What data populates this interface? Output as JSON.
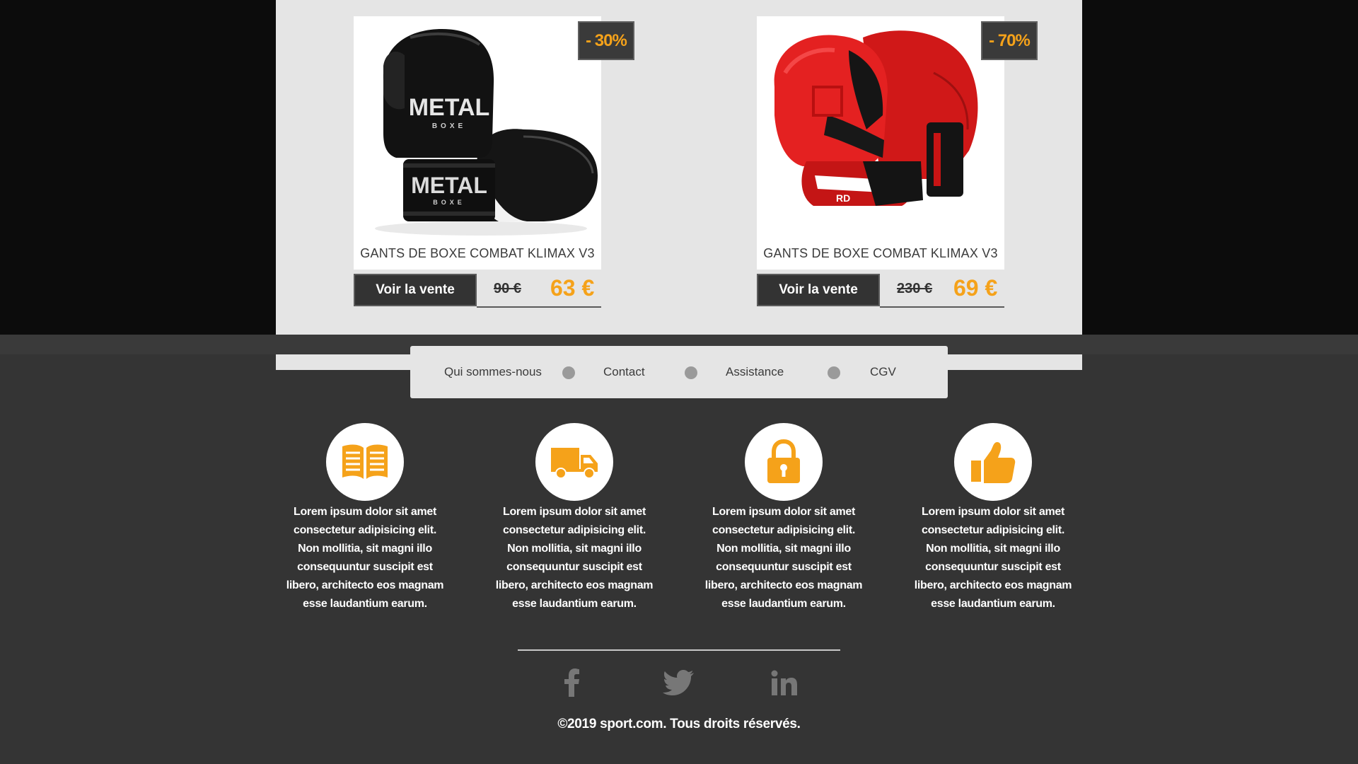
{
  "colors": {
    "accent": "#f5a21a",
    "dark_band": "#0c0c0c",
    "footer_bg": "#343434",
    "panel_bg": "#e5e5e5"
  },
  "products": [
    {
      "title": "GANTS DE BOXE COMBAT KLIMAX V3",
      "discount": "- 30%",
      "button_label": "Voir la vente",
      "old_price": "90 €",
      "new_price": "63 €",
      "image": "black-boxing-gloves-metal-boxe",
      "image_brand": "METAL"
    },
    {
      "title": "GANTS DE BOXE COMBAT KLIMAX V3",
      "discount": "- 70%",
      "button_label": "Voir la vente",
      "old_price": "230 €",
      "new_price": "69 €",
      "image": "red-boxing-gloves"
    }
  ],
  "nav": {
    "items": [
      {
        "label": "Qui sommes-nous"
      },
      {
        "label": "Contact"
      },
      {
        "label": "Assistance"
      },
      {
        "label": "CGV"
      }
    ]
  },
  "features": [
    {
      "icon": "book-icon",
      "text": "Lorem ipsum dolor sit amet consectetur adipisicing elit. Non mollitia, sit magni illo consequuntur suscipit est libero, architecto eos magnam esse laudantium earum."
    },
    {
      "icon": "truck-icon",
      "text": "Lorem ipsum dolor sit amet consectetur adipisicing elit. Non mollitia, sit magni illo consequuntur suscipit est libero, architecto eos magnam esse laudantium earum."
    },
    {
      "icon": "lock-icon",
      "text": "Lorem ipsum dolor sit amet consectetur adipisicing elit. Non mollitia, sit magni illo consequuntur suscipit est libero, architecto eos magnam esse laudantium earum."
    },
    {
      "icon": "thumbs-up-icon",
      "text": "Lorem ipsum dolor sit amet consectetur adipisicing elit. Non mollitia, sit magni illo consequuntur suscipit est libero, architecto eos magnam esse laudantium earum."
    }
  ],
  "social": [
    "facebook-icon",
    "twitter-icon",
    "linkedin-icon"
  ],
  "footer": {
    "copyright": "©2019 sport.com. Tous droits réservés."
  }
}
